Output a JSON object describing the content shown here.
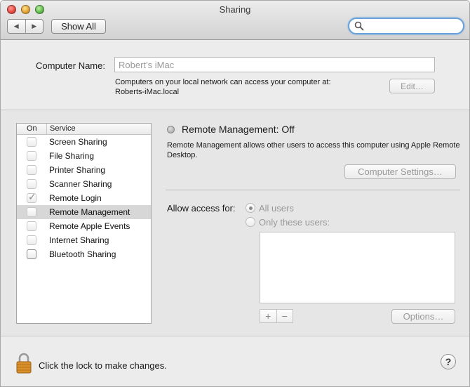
{
  "window": {
    "title": "Sharing"
  },
  "toolbar": {
    "back_glyph": "◀",
    "forward_glyph": "▶",
    "show_all_label": "Show All",
    "search_placeholder": "",
    "search_icon": "magnifier-icon"
  },
  "computer_name": {
    "label": "Computer Name:",
    "value": "Robert’s iMac",
    "info_line1": "Computers on your local network can access your computer at:",
    "info_line2": "Roberts-iMac.local",
    "edit_label": "Edit…"
  },
  "service_list": {
    "header_on": "On",
    "header_service": "Service",
    "items": [
      {
        "label": "Screen Sharing",
        "checked": false,
        "enabled": false,
        "selected": false
      },
      {
        "label": "File Sharing",
        "checked": false,
        "enabled": false,
        "selected": false
      },
      {
        "label": "Printer Sharing",
        "checked": false,
        "enabled": false,
        "selected": false
      },
      {
        "label": "Scanner Sharing",
        "checked": false,
        "enabled": false,
        "selected": false
      },
      {
        "label": "Remote Login",
        "checked": true,
        "enabled": false,
        "selected": false
      },
      {
        "label": "Remote Management",
        "checked": false,
        "enabled": false,
        "selected": true
      },
      {
        "label": "Remote Apple Events",
        "checked": false,
        "enabled": false,
        "selected": false
      },
      {
        "label": "Internet Sharing",
        "checked": false,
        "enabled": false,
        "selected": false
      },
      {
        "label": "Bluetooth Sharing",
        "checked": false,
        "enabled": true,
        "selected": false
      }
    ]
  },
  "detail": {
    "status": "Remote Management: Off",
    "description": "Remote Management allows other users to access this computer using Apple Remote Desktop.",
    "computer_settings_label": "Computer Settings…",
    "allow_access_label": "Allow access for:",
    "radio_all_users": "All users",
    "radio_only_these": "Only these users:",
    "plus_label": "+",
    "minus_label": "−",
    "options_label": "Options…"
  },
  "footer": {
    "lock_text": "Click the lock to make changes.",
    "help_label": "?"
  }
}
